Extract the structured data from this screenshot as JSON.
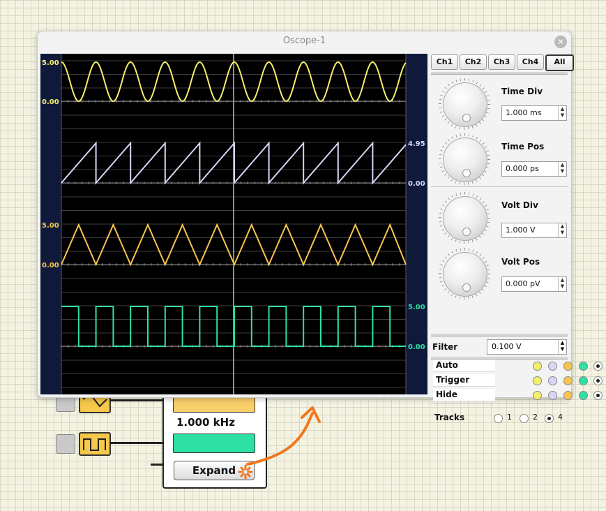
{
  "window": {
    "title": "Oscope-1"
  },
  "tabs": [
    {
      "label": "Ch1"
    },
    {
      "label": "Ch2"
    },
    {
      "label": "Ch3"
    },
    {
      "label": "Ch4"
    },
    {
      "label": "All"
    }
  ],
  "controls": {
    "time_div": {
      "label": "Time Div",
      "value": "1.000 ms"
    },
    "time_pos": {
      "label": "Time Pos",
      "value": "0.000 ps"
    },
    "volt_div": {
      "label": "Volt Div",
      "value": "1.000 V"
    },
    "volt_pos": {
      "label": "Volt Pos",
      "value": "0.000 pV"
    }
  },
  "filter": {
    "label": "Filter",
    "value": "0.100 V"
  },
  "channel_rows": [
    {
      "label": "Auto"
    },
    {
      "label": "Trigger"
    },
    {
      "label": "Hide"
    }
  ],
  "channel_colors": [
    "#f5ef6b",
    "#d7d6f7",
    "#f9c54e",
    "#2fe0a5"
  ],
  "tracks": {
    "label": "Tracks",
    "options": [
      "1",
      "2",
      "4"
    ],
    "selected": "4"
  },
  "scope": {
    "background": "#000000",
    "axis_color": "#0f1a3a",
    "traces": [
      {
        "color": "#f5ef6b",
        "top_label": "5.00",
        "bottom_label": "0.00",
        "label_side": "left"
      },
      {
        "color": "#d7d6f7",
        "top_label": "4.95",
        "bottom_label": "0.00",
        "label_side": "right"
      },
      {
        "color": "#f9c54e",
        "top_label": "5.00",
        "bottom_label": "0.00",
        "label_side": "left"
      },
      {
        "color": "#2fe0a5",
        "top_label": "5.00",
        "bottom_label": "0.00",
        "label_side": "right"
      }
    ]
  },
  "circuit": {
    "frequency": "1.000 kHz",
    "expand_label": "Expand"
  }
}
